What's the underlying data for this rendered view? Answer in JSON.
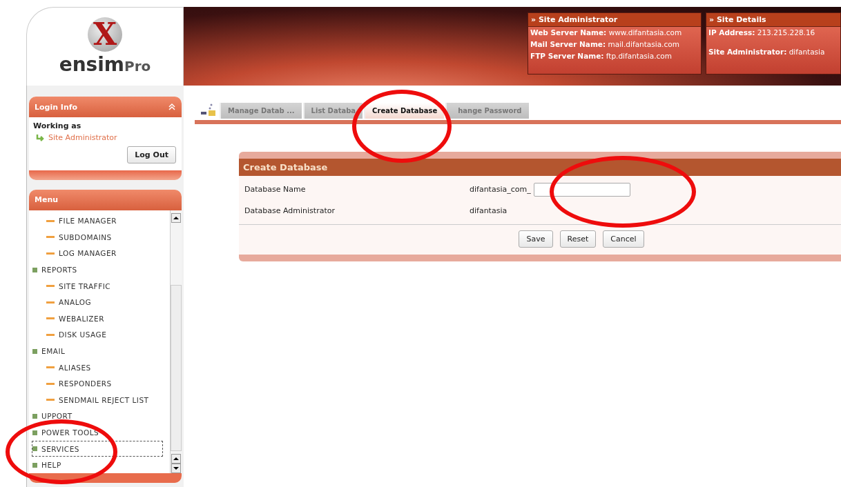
{
  "logo": {
    "mark": "X",
    "name": "ensim",
    "suffix": "Pro"
  },
  "header_panels": [
    {
      "title": "» Site Administrator",
      "fields": [
        {
          "label": "Web Server Name:",
          "value": "www.difantasia.com"
        },
        {
          "label": "Mail Server Name:",
          "value": "mail.difantasia.com"
        },
        {
          "label": "FTP Server Name:",
          "value": "ftp.difantasia.com"
        }
      ]
    },
    {
      "title": "» Site Details",
      "fields": [
        {
          "label": "IP Address:",
          "value": "213.215.228.16"
        },
        {
          "label": "Site Administrator:",
          "value": "difantasia"
        }
      ]
    }
  ],
  "login_info": {
    "title": "Login Info",
    "working_as": "Working as",
    "user": "Site Administrator",
    "logout": "Log Out"
  },
  "menu": {
    "title": "Menu",
    "items": [
      {
        "kind": "sub",
        "label": "FILE MANAGER",
        "selected": false
      },
      {
        "kind": "sub",
        "label": "SUBDOMAINS",
        "selected": false
      },
      {
        "kind": "sub",
        "label": "LOG MANAGER",
        "selected": false
      },
      {
        "kind": "group",
        "label": "REPORTS",
        "selected": false
      },
      {
        "kind": "sub",
        "label": "SITE TRAFFIC",
        "selected": false
      },
      {
        "kind": "sub",
        "label": "ANALOG",
        "selected": false
      },
      {
        "kind": "sub",
        "label": "WEBALIZER",
        "selected": false
      },
      {
        "kind": "sub",
        "label": "DISK USAGE",
        "selected": false
      },
      {
        "kind": "group",
        "label": "EMAIL",
        "selected": false
      },
      {
        "kind": "sub",
        "label": "ALIASES",
        "selected": false
      },
      {
        "kind": "sub",
        "label": "RESPONDERS",
        "selected": false
      },
      {
        "kind": "sub",
        "label": "SENDMAIL REJECT LIST",
        "selected": false
      },
      {
        "kind": "group",
        "label": "UPPORT",
        "selected": false
      },
      {
        "kind": "group",
        "label": "POWER TOOLS",
        "selected": false
      },
      {
        "kind": "group",
        "label": "SERVICES",
        "selected": true
      },
      {
        "kind": "group",
        "label": "HELP",
        "selected": false
      }
    ]
  },
  "tabs": [
    {
      "label": "Manage Datab ...",
      "selected": false
    },
    {
      "label": "List Databa",
      "selected": false
    },
    {
      "label": "Create Database",
      "selected": true
    },
    {
      "label": "hange Password",
      "selected": false
    }
  ],
  "form": {
    "title": "Create Database",
    "rows": [
      {
        "kind": "input",
        "label": "Database Name",
        "prefix": "difantasia_com_"
      },
      {
        "kind": "text",
        "label": "Database Administrator",
        "value": "difantasia"
      }
    ],
    "buttons": [
      "Save",
      "Reset",
      "Cancel"
    ]
  }
}
